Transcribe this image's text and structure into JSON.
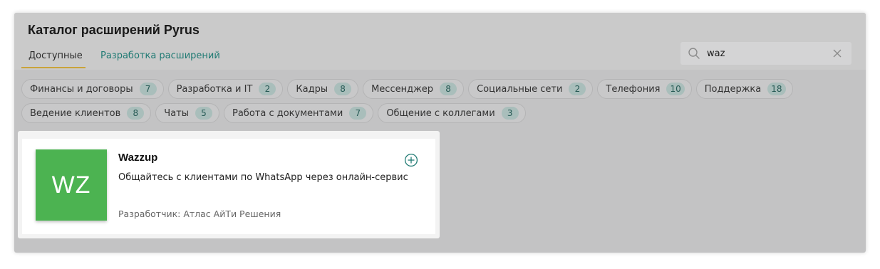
{
  "header": {
    "title": "Каталог расширений Pyrus",
    "tabs": [
      {
        "label": "Доступные",
        "active": true
      },
      {
        "label": "Разработка расширений",
        "active": false
      }
    ]
  },
  "search": {
    "value": "waz",
    "icon": "search-icon",
    "clear_icon": "close-icon"
  },
  "categories": [
    {
      "label": "Финансы и договоры",
      "count": "7"
    },
    {
      "label": "Разработка и IT",
      "count": "2"
    },
    {
      "label": "Кадры",
      "count": "8"
    },
    {
      "label": "Мессенджер",
      "count": "8"
    },
    {
      "label": "Социальные сети",
      "count": "2"
    },
    {
      "label": "Телефония",
      "count": "10"
    },
    {
      "label": "Поддержка",
      "count": "18"
    },
    {
      "label": "Ведение клиентов",
      "count": "8"
    },
    {
      "label": "Чаты",
      "count": "5"
    },
    {
      "label": "Работа с документами",
      "count": "7"
    },
    {
      "label": "Общение с коллегами",
      "count": "3"
    }
  ],
  "results": [
    {
      "logo_text": "WZ",
      "name": "Wazzup",
      "description": "Общайтесь с клиентами по WhatsApp через онлайн-сервис",
      "developer": "Разработчик: Атлас АйТи Решения",
      "add_icon": "plus-circle-icon"
    }
  ],
  "colors": {
    "accent_teal": "#1f7a73",
    "tab_underline": "#c9a33a",
    "logo_green": "#4cb351"
  }
}
